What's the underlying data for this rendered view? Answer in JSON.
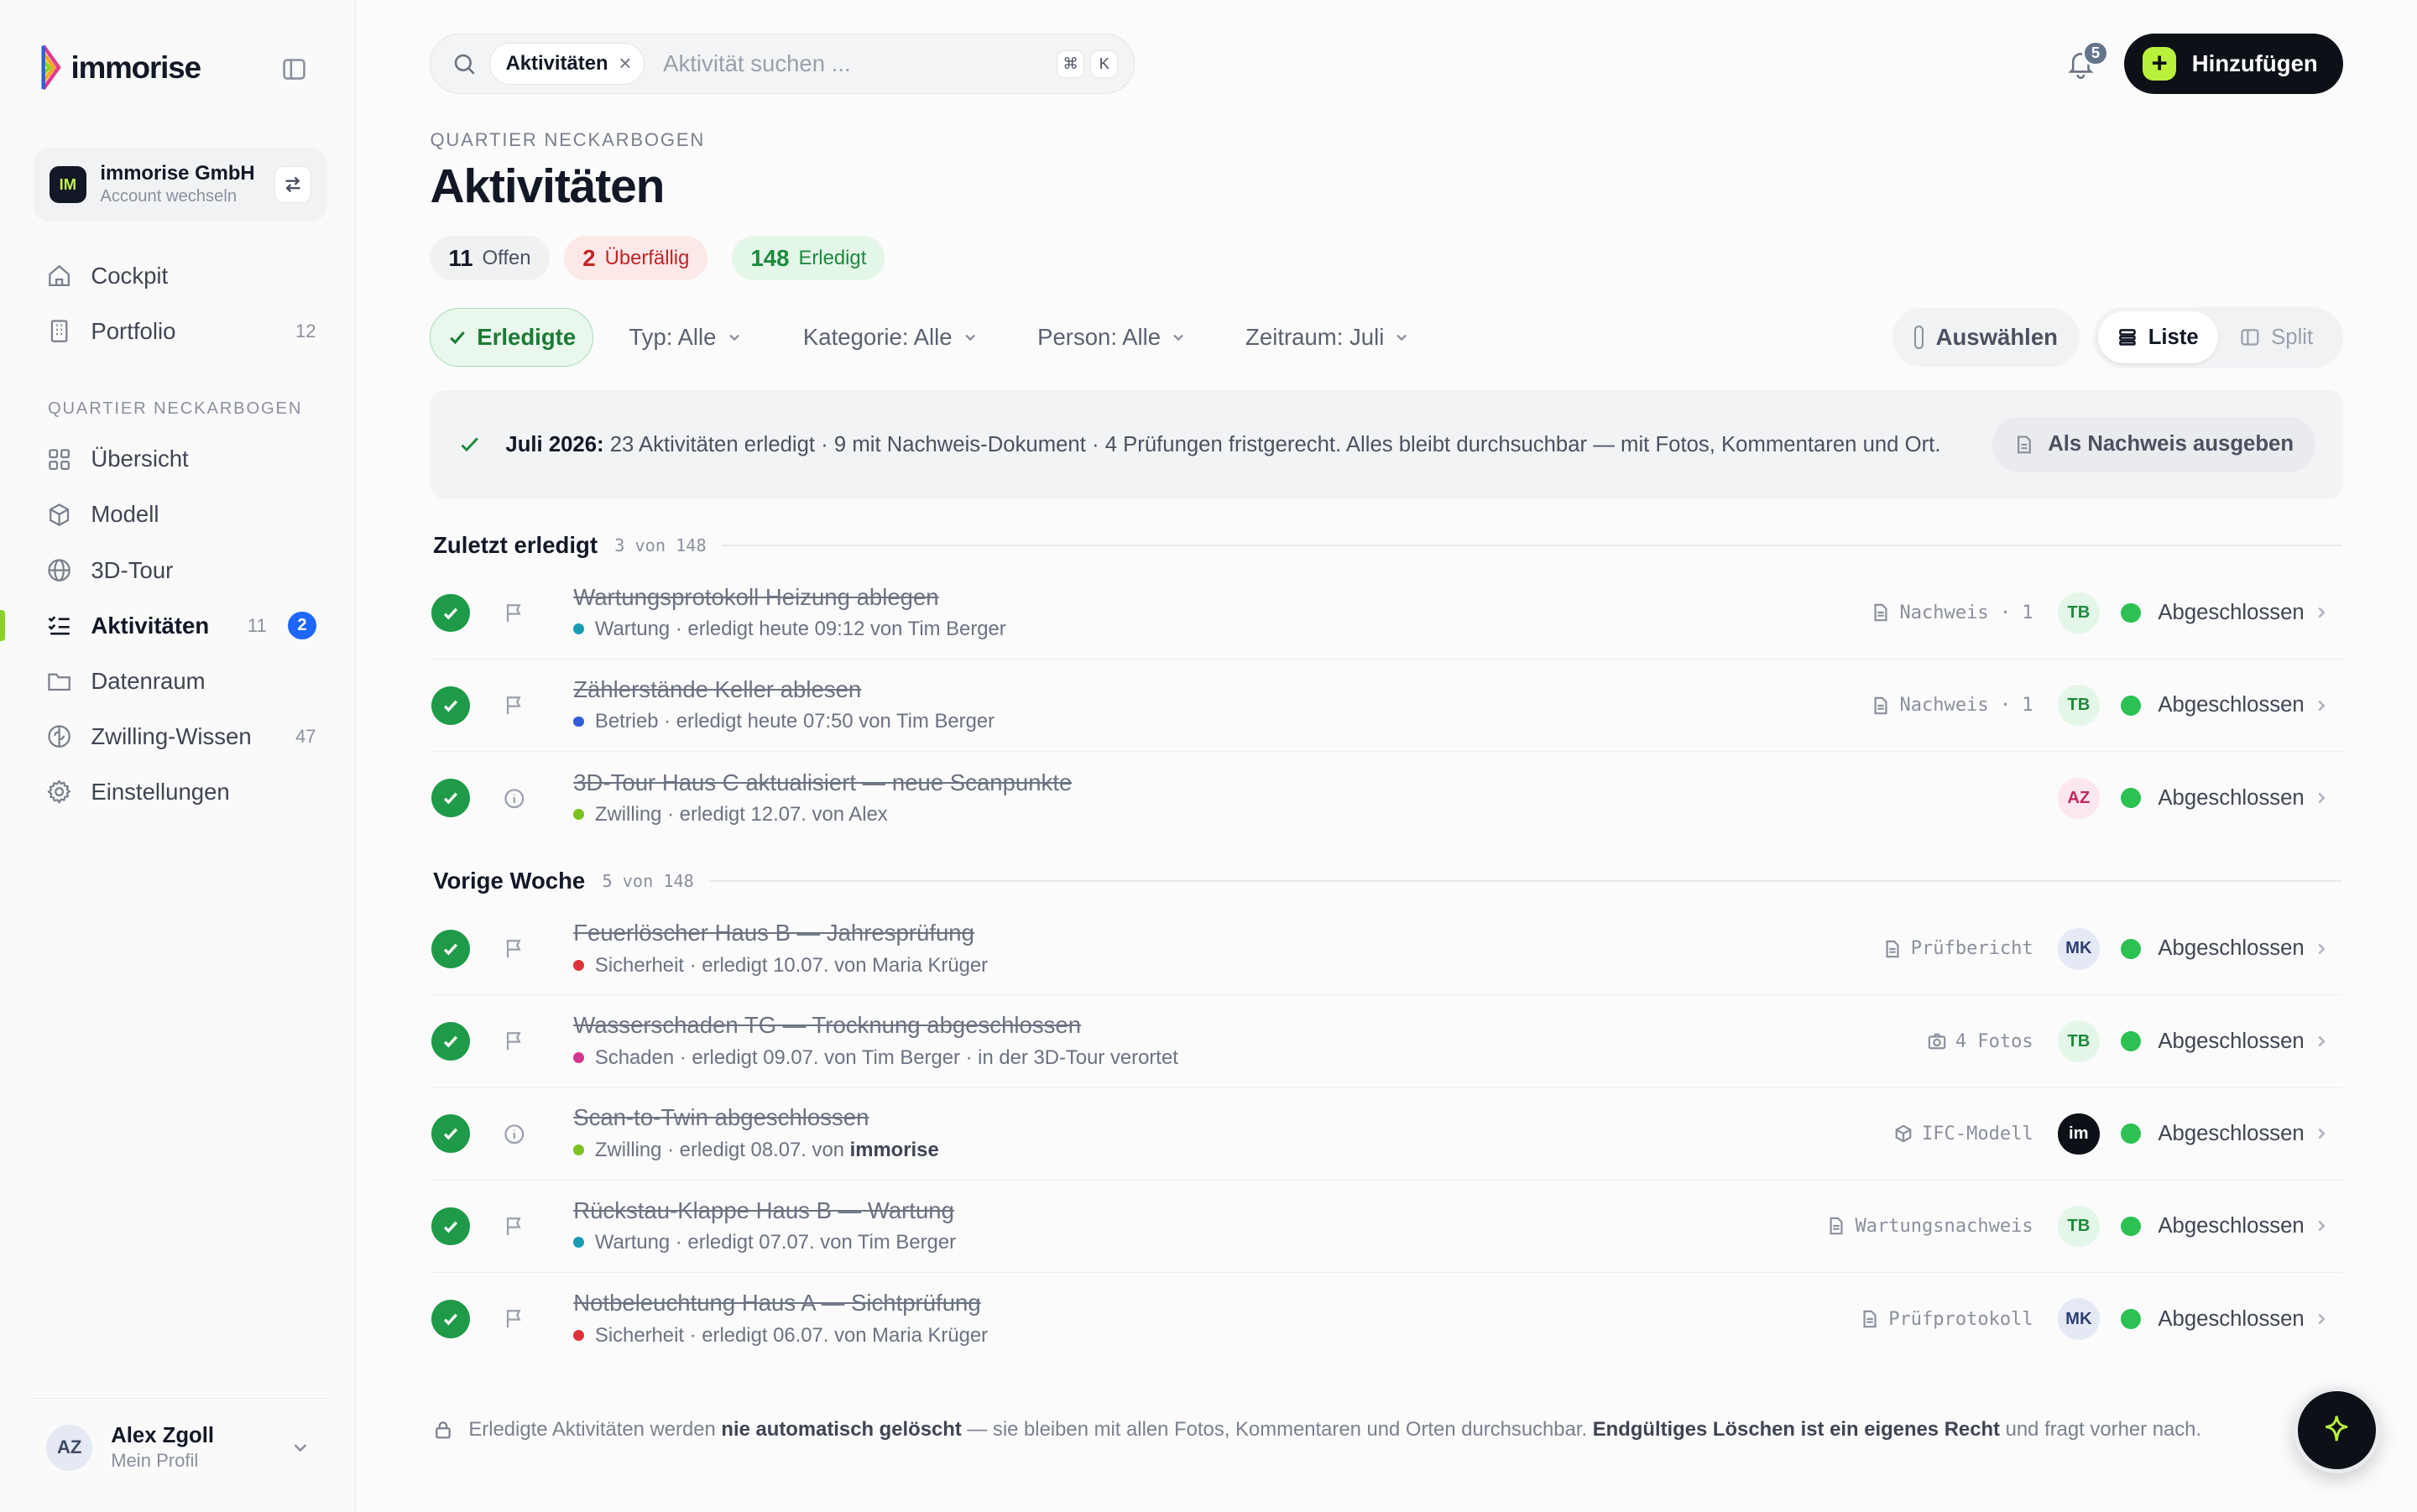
{
  "brand": {
    "name": "immorise"
  },
  "account": {
    "initials": "IM",
    "name": "immorise GmbH",
    "sub": "Account wechseln"
  },
  "nav_top": [
    {
      "label": "Cockpit",
      "icon": "home-icon",
      "count": ""
    },
    {
      "label": "Portfolio",
      "icon": "building-icon",
      "count": "12"
    }
  ],
  "nav_section_label": "QUARTIER NECKARBOGEN",
  "nav": [
    {
      "label": "Übersicht",
      "icon": "grid-icon",
      "count": ""
    },
    {
      "label": "Modell",
      "icon": "cube-icon",
      "count": ""
    },
    {
      "label": "3D-Tour",
      "icon": "globe-icon",
      "count": ""
    },
    {
      "label": "Aktivitäten",
      "icon": "checklist-icon",
      "count": "11",
      "badge": "2",
      "active": true
    },
    {
      "label": "Datenraum",
      "icon": "folder-icon",
      "count": ""
    },
    {
      "label": "Zwilling-Wissen",
      "icon": "brain-icon",
      "count": "47"
    },
    {
      "label": "Einstellungen",
      "icon": "gear-icon",
      "count": ""
    }
  ],
  "profile": {
    "initials": "AZ",
    "name": "Alex Zgoll",
    "sub": "Mein Profil"
  },
  "search": {
    "chip": "Aktivitäten",
    "placeholder": "Aktivität suchen ...",
    "kbd1": "⌘",
    "kbd2": "K"
  },
  "notifications": {
    "count": "5"
  },
  "add_button": {
    "label": "Hinzufügen"
  },
  "header": {
    "eyebrow": "QUARTIER NECKARBOGEN",
    "title": "Aktivitäten"
  },
  "stats": {
    "open": {
      "value": "11",
      "label": "Offen"
    },
    "overdue": {
      "value": "2",
      "label": "Überfällig"
    },
    "done": {
      "value": "148",
      "label": "Erledigt"
    }
  },
  "filters": {
    "done_toggle": "Erledigte",
    "type": "Typ: Alle",
    "category": "Kategorie: Alle",
    "person": "Person: Alle",
    "period": "Zeitraum: Juli",
    "select": "Auswählen",
    "view_list": "Liste",
    "view_split": "Split"
  },
  "summary": {
    "lead": "Juli 2026:",
    "text": " 23 Aktivitäten erledigt · 9 mit Nachweis-Dokument · 4 Prüfungen fristgerecht. Alles bleibt durchsuchbar — mit Fotos, Kommentaren und Ort.",
    "button": "Als Nachweis ausgeben"
  },
  "groups": [
    {
      "title": "Zuletzt erledigt",
      "count": "3 von 148",
      "rows": [
        {
          "title": "Wartungsprotokoll Heizung ablegen",
          "category": "Wartung",
          "dot": "#1a9bb4",
          "meta": "erledigt heute 09:12 von Tim Berger",
          "meta_bold": "",
          "meta_tail": "",
          "icon": "flag",
          "attach_icon": "doc",
          "attach": "Nachweis · 1",
          "initials": "TB",
          "av_bg": "#e3f6e8",
          "av_fg": "#1d8a3c",
          "status": "Abgeschlossen"
        },
        {
          "title": "Zählerstände Keller ablesen",
          "category": "Betrieb",
          "dot": "#2f5fd6",
          "meta": "erledigt heute 07:50 von Tim Berger",
          "meta_bold": "",
          "meta_tail": "",
          "icon": "flag",
          "attach_icon": "doc",
          "attach": "Nachweis · 1",
          "initials": "TB",
          "av_bg": "#e3f6e8",
          "av_fg": "#1d8a3c",
          "status": "Abgeschlossen"
        },
        {
          "title": "3D-Tour Haus C aktualisiert — neue Scanpunkte",
          "category": "Zwilling",
          "dot": "#7cc21f",
          "meta": "erledigt 12.07. von Alex",
          "meta_bold": "",
          "meta_tail": "",
          "icon": "info",
          "attach_icon": "",
          "attach": "",
          "initials": "AZ",
          "av_bg": "#fde7ef",
          "av_fg": "#c2285f",
          "status": "Abgeschlossen"
        }
      ]
    },
    {
      "title": "Vorige Woche",
      "count": "5 von 148",
      "rows": [
        {
          "title": "Feuerlöscher Haus B — Jahresprüfung",
          "category": "Sicherheit",
          "dot": "#e0323a",
          "meta": "erledigt 10.07. von Maria Krüger",
          "meta_bold": "",
          "meta_tail": "",
          "icon": "flag",
          "attach_icon": "doc",
          "attach": "Prüfbericht",
          "initials": "MK",
          "av_bg": "#e4e9f5",
          "av_fg": "#2e3f72",
          "status": "Abgeschlossen"
        },
        {
          "title": "Wasserschaden TG — Trocknung abgeschlossen",
          "category": "Schaden",
          "dot": "#d6358f",
          "meta": "erledigt 09.07. von Tim Berger · in der 3D-Tour verortet",
          "meta_bold": "",
          "meta_tail": "",
          "icon": "flag",
          "attach_icon": "camera",
          "attach": "4 Fotos",
          "initials": "TB",
          "av_bg": "#e3f6e8",
          "av_fg": "#1d8a3c",
          "status": "Abgeschlossen"
        },
        {
          "title": "Scan-to-Twin abgeschlossen",
          "category": "Zwilling",
          "dot": "#7cc21f",
          "meta": "erledigt 08.07. von ",
          "meta_bold": "immorise",
          "meta_tail": "",
          "icon": "info",
          "attach_icon": "cube",
          "attach": "IFC-Modell",
          "initials": "im",
          "av_bg": "#0d1117",
          "av_fg": "#ffffff",
          "status": "Abgeschlossen"
        },
        {
          "title": "Rückstau-Klappe Haus B — Wartung",
          "category": "Wartung",
          "dot": "#1a9bb4",
          "meta": "erledigt 07.07. von Tim Berger",
          "meta_bold": "",
          "meta_tail": "",
          "icon": "flag",
          "attach_icon": "doc",
          "attach": "Wartungsnachweis",
          "initials": "TB",
          "av_bg": "#e3f6e8",
          "av_fg": "#1d8a3c",
          "status": "Abgeschlossen"
        },
        {
          "title": "Notbeleuchtung Haus A — Sichtprüfung",
          "category": "Sicherheit",
          "dot": "#e0323a",
          "meta": "erledigt 06.07. von Maria Krüger",
          "meta_bold": "",
          "meta_tail": "",
          "icon": "flag",
          "attach_icon": "doc",
          "attach": "Prüfprotokoll",
          "initials": "MK",
          "av_bg": "#e4e9f5",
          "av_fg": "#2e3f72",
          "status": "Abgeschlossen"
        }
      ]
    }
  ],
  "footnote": {
    "t1": "Erledigte Aktivitäten werden ",
    "b1": "nie automatisch gelöscht",
    "t2": " — sie bleiben mit allen Fotos, Kommentaren und Orten durchsuchbar. ",
    "b2": "Endgültiges Löschen ist ein eigenes Recht",
    "t3": " und fragt vorher nach."
  }
}
